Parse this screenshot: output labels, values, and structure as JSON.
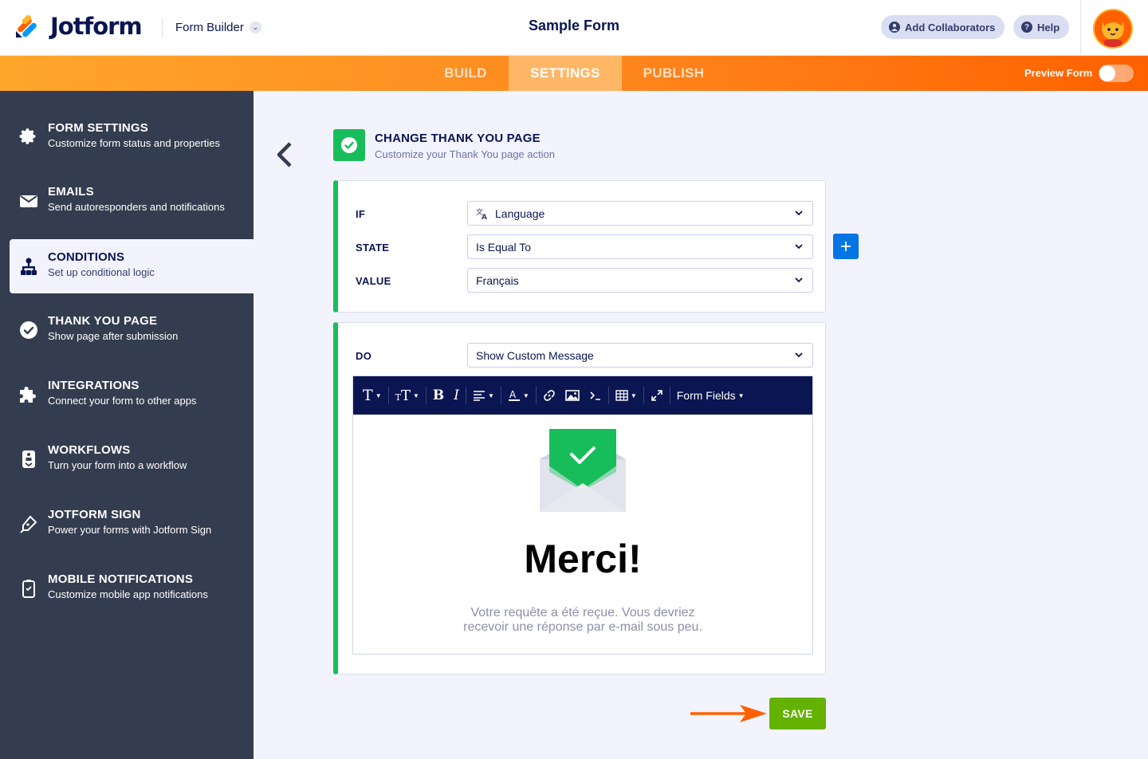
{
  "header": {
    "logo_text": "Jotform",
    "builder_label": "Form Builder",
    "form_title": "Sample Form",
    "add_collaborators": "Add Collaborators",
    "help": "Help"
  },
  "nav": {
    "tabs": [
      {
        "label": "BUILD",
        "active": false
      },
      {
        "label": "SETTINGS",
        "active": true
      },
      {
        "label": "PUBLISH",
        "active": false
      }
    ],
    "preview_label": "Preview Form",
    "preview_on": false
  },
  "sidebar": {
    "items": [
      {
        "title": "FORM SETTINGS",
        "subtitle": "Customize form status and properties",
        "icon": "gear-icon"
      },
      {
        "title": "EMAILS",
        "subtitle": "Send autoresponders and notifications",
        "icon": "envelope-icon"
      },
      {
        "title": "CONDITIONS",
        "subtitle": "Set up conditional logic",
        "icon": "conditions-icon",
        "active": true
      },
      {
        "title": "THANK YOU PAGE",
        "subtitle": "Show page after submission",
        "icon": "check-circle-icon"
      },
      {
        "title": "INTEGRATIONS",
        "subtitle": "Connect your form to other apps",
        "icon": "puzzle-icon"
      },
      {
        "title": "WORKFLOWS",
        "subtitle": "Turn your form into a workflow",
        "icon": "workflow-icon"
      },
      {
        "title": "JOTFORM SIGN",
        "subtitle": "Power your forms with Jotform Sign",
        "icon": "pen-icon"
      },
      {
        "title": "MOBILE NOTIFICATIONS",
        "subtitle": "Customize mobile app notifications",
        "icon": "mobile-icon"
      }
    ]
  },
  "section": {
    "title": "CHANGE THANK YOU PAGE",
    "subtitle": "Customize your Thank You page action"
  },
  "condition": {
    "if_label": "IF",
    "if_value": "Language",
    "state_label": "STATE",
    "state_value": "Is Equal To",
    "value_label": "VALUE",
    "value_value": "Français"
  },
  "action": {
    "do_label": "DO",
    "do_value": "Show Custom Message",
    "toolbar_form_fields": "Form Fields",
    "message_title": "Merci!",
    "message_body": "Votre requête a été reçue. Vous devriez recevoir une réponse par e-mail sous peu."
  },
  "save_label": "SAVE",
  "colors": {
    "accent_green": "#18bd5b",
    "save_green": "#64b200",
    "nav_orange": "#ff6100",
    "sidebar_dark": "#343c4f",
    "primary_blue": "#0075e3"
  }
}
